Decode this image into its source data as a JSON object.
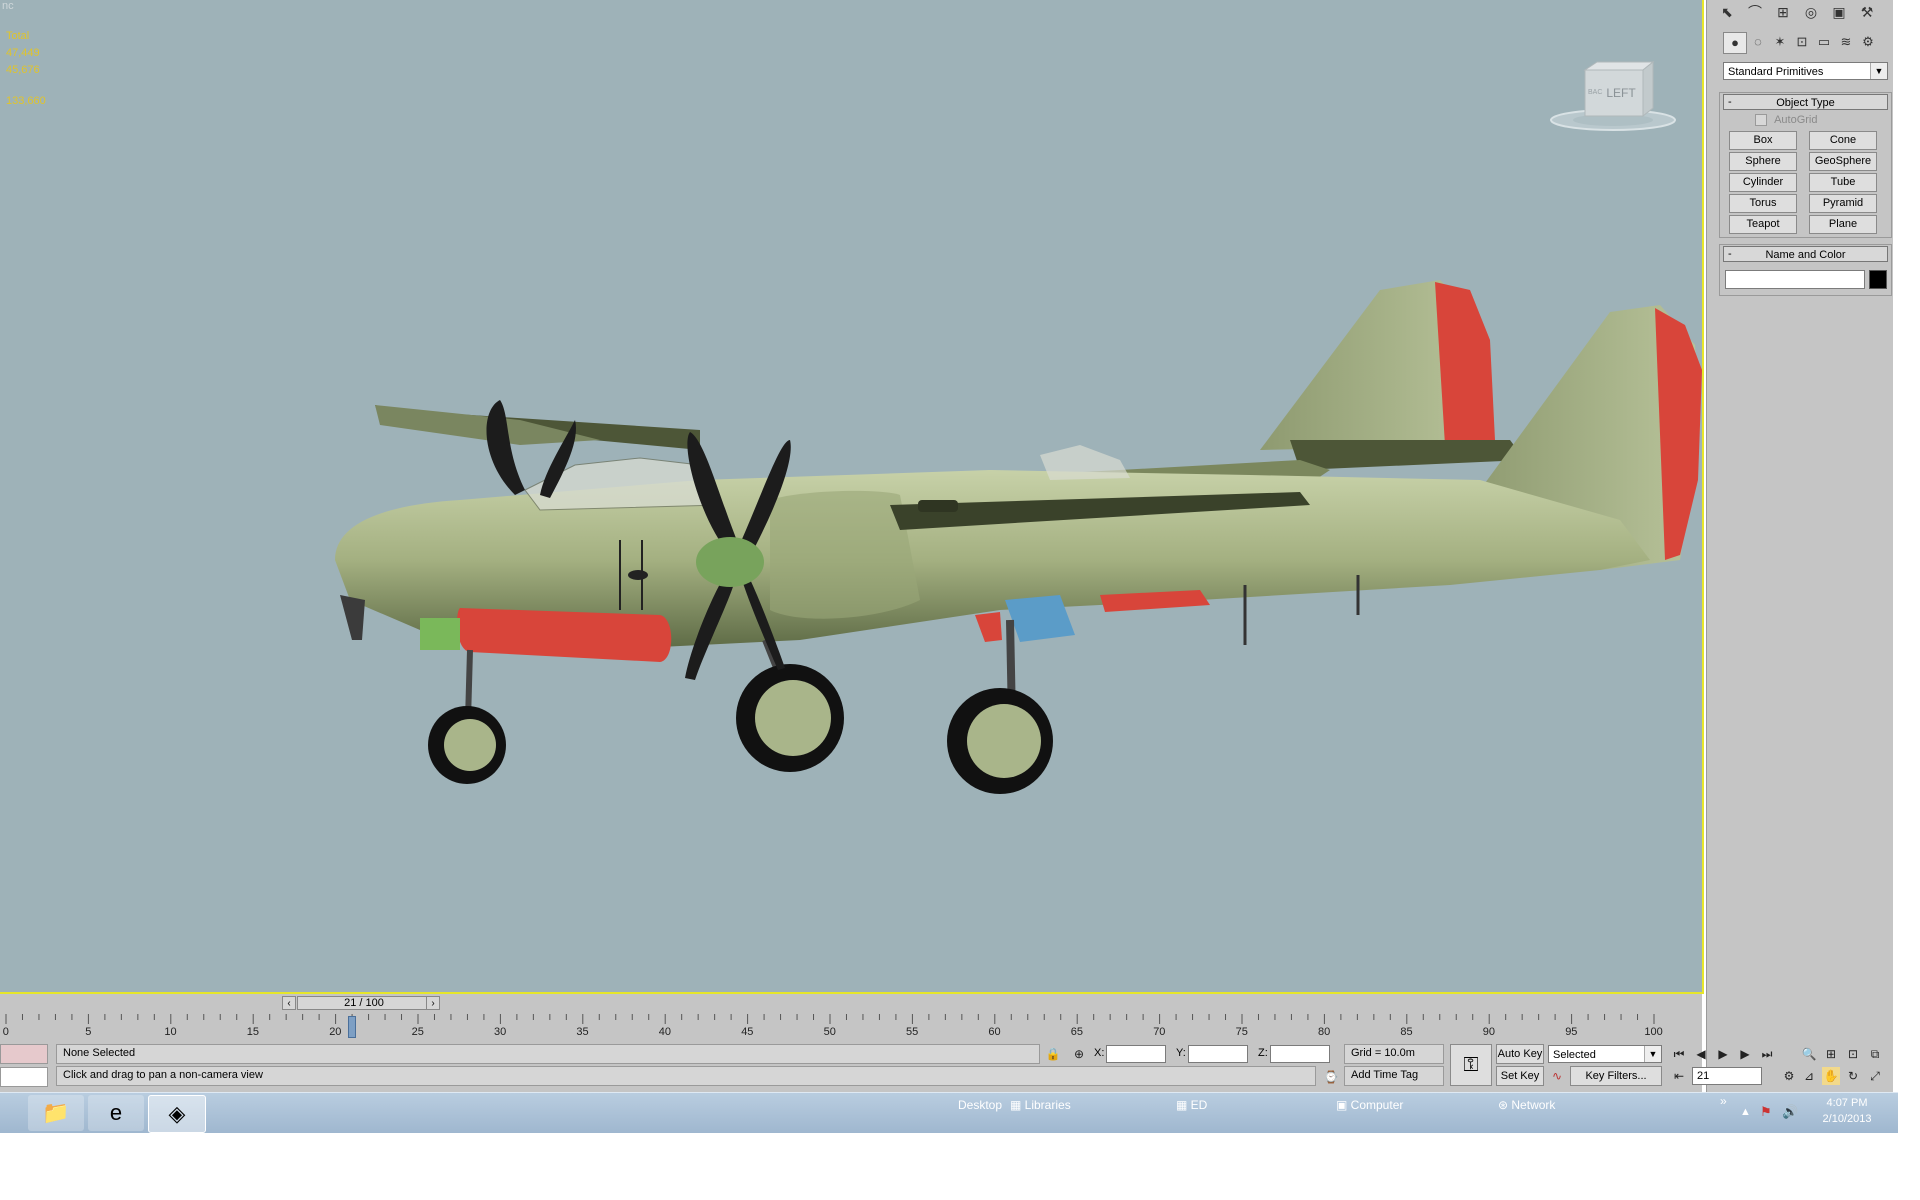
{
  "viewport": {
    "label": "nc",
    "stats": [
      "Total",
      "47,449",
      "45,676",
      "133,660"
    ],
    "viewcube_label": "LEFT",
    "viewcube_side": "BAC",
    "background": "#9eb2b8",
    "border_color": "#e6e62a"
  },
  "aircraft": {
    "body_color": "#a9b58a",
    "accent_color": "#d8453a",
    "pod_blue": "#5b9cc8",
    "pod_green": "#7ab85a"
  },
  "command_panel": {
    "tabs": [
      "select-icon",
      "modify-icon",
      "hierarchy-icon",
      "motion-icon",
      "display-icon",
      "utilities-icon"
    ],
    "subtabs": [
      "geometry-icon",
      "shapes-icon",
      "lights-icon",
      "cameras-icon",
      "helpers-icon",
      "spacewarps-icon",
      "systems-icon"
    ],
    "category": "Standard Primitives",
    "object_type": {
      "title": "Object Type",
      "autogrid": "AutoGrid",
      "buttons": [
        "Box",
        "Cone",
        "Sphere",
        "GeoSphere",
        "Cylinder",
        "Tube",
        "Torus",
        "Pyramid",
        "Teapot",
        "Plane"
      ]
    },
    "name_and_color": {
      "title": "Name and Color",
      "name_value": "",
      "color": "#000000"
    }
  },
  "timeline": {
    "slider_text": "21 / 100",
    "current_frame": 21,
    "ticks": [
      "0",
      "5",
      "10",
      "15",
      "20",
      "25",
      "30",
      "35",
      "40",
      "45",
      "50",
      "55",
      "60",
      "65",
      "70",
      "75",
      "80",
      "85",
      "90",
      "95",
      "100"
    ]
  },
  "status": {
    "selection": "None Selected",
    "prompt": "Click and drag to pan a non-camera view",
    "x_label": "X:",
    "y_label": "Y:",
    "z_label": "Z:",
    "x_value": "",
    "y_value": "",
    "z_value": "",
    "grid": "Grid = 10.0m",
    "add_time_tag": "Add Time Tag",
    "auto_key": "Auto Key",
    "set_key": "Set Key",
    "key_mode": "Selected",
    "key_filters": "Key Filters...",
    "frame_value": "21"
  },
  "taskbar": {
    "apps": [
      "explorer-icon",
      "internet-explorer-icon",
      "3dsmax-icon"
    ],
    "desktop": "Desktop",
    "links": [
      "Libraries",
      "ED",
      "Computer",
      "Network"
    ],
    "chevron": "»",
    "time": "4:07 PM",
    "date": "2/10/2013"
  }
}
